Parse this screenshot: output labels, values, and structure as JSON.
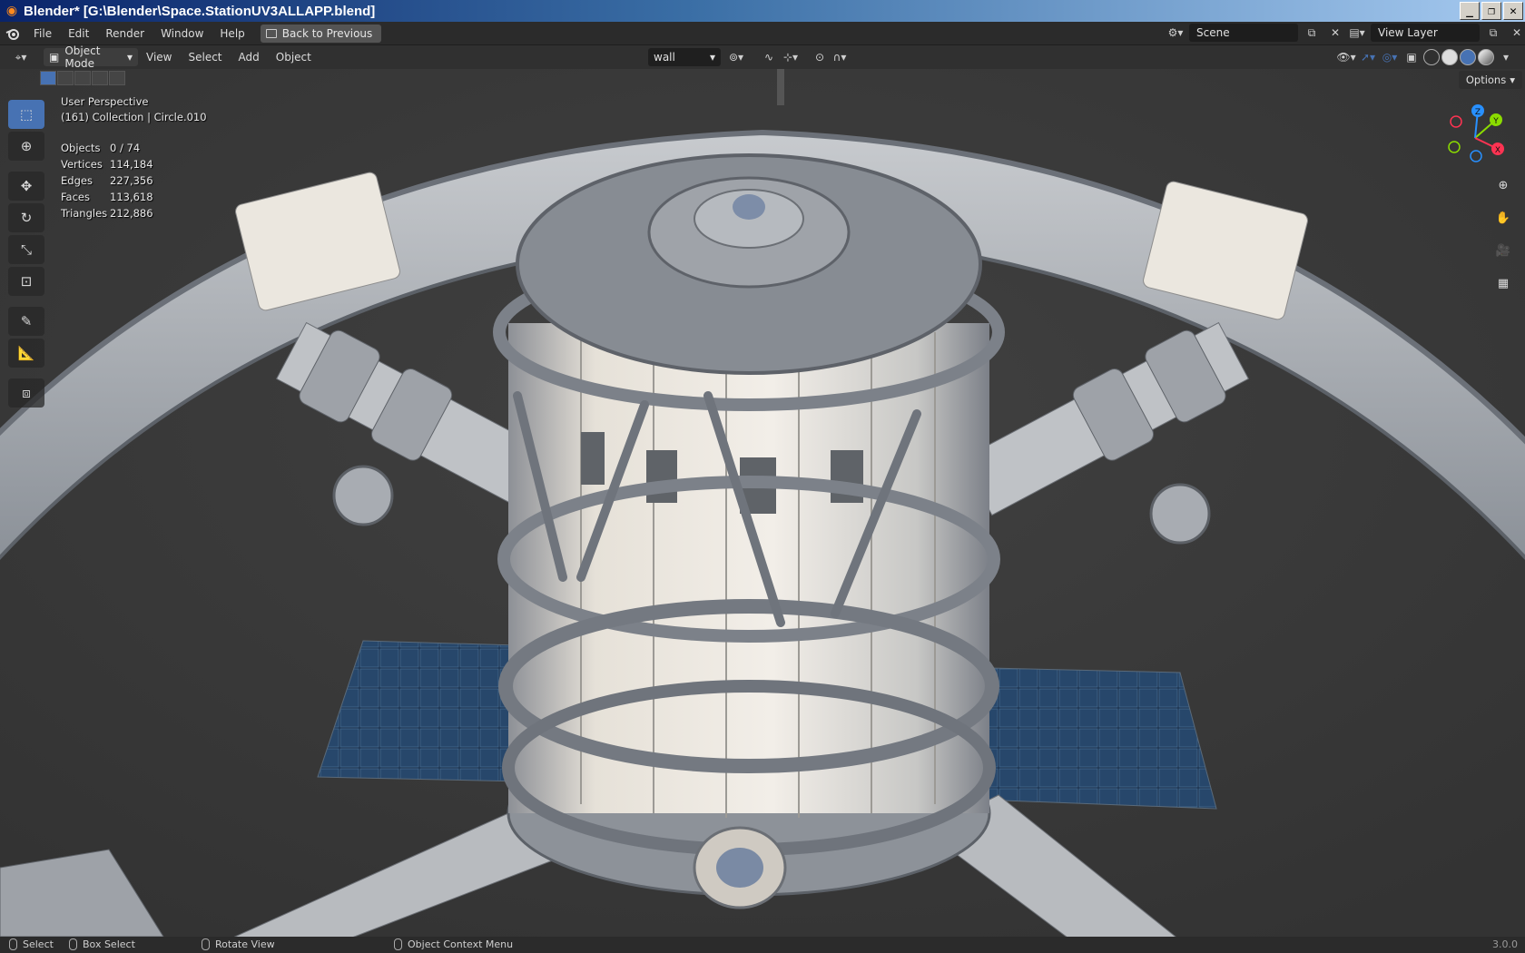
{
  "window": {
    "title": "Blender* [G:\\Blender\\Space.StationUV3ALLAPP.blend]",
    "controls": [
      "_",
      "❐",
      "✕"
    ]
  },
  "menubar": {
    "items": [
      "File",
      "Edit",
      "Render",
      "Window",
      "Help"
    ],
    "back_label": "Back to Previous",
    "scene_label": "Scene",
    "view_layer_label": "View Layer"
  },
  "viewport_header": {
    "mode": "Object Mode",
    "menus": [
      "View",
      "Select",
      "Add",
      "Object"
    ],
    "orientation": "wall",
    "options_label": "Options"
  },
  "viewport": {
    "perspective": "User Perspective",
    "collection": "(161) Collection | Circle.010",
    "stats": [
      {
        "label": "Objects",
        "value": "0 / 74"
      },
      {
        "label": "Vertices",
        "value": "114,184"
      },
      {
        "label": "Edges",
        "value": "227,356"
      },
      {
        "label": "Faces",
        "value": "113,618"
      },
      {
        "label": "Triangles",
        "value": "212,886"
      }
    ],
    "gizmo_axes": [
      "Z",
      "Y",
      "X"
    ]
  },
  "tools": [
    "select-box",
    "cursor",
    "move",
    "rotate",
    "scale",
    "transform",
    "annotate",
    "measure",
    "add-cube"
  ],
  "statusbar": {
    "select": "Select",
    "box_select": "Box Select",
    "rotate_view": "Rotate View",
    "context_menu": "Object Context Menu",
    "version": "3.0.0"
  },
  "colors": {
    "accent": "#4772b3",
    "axis_x": "#ff3352",
    "axis_y": "#8bdc00",
    "axis_z": "#2890ff"
  }
}
